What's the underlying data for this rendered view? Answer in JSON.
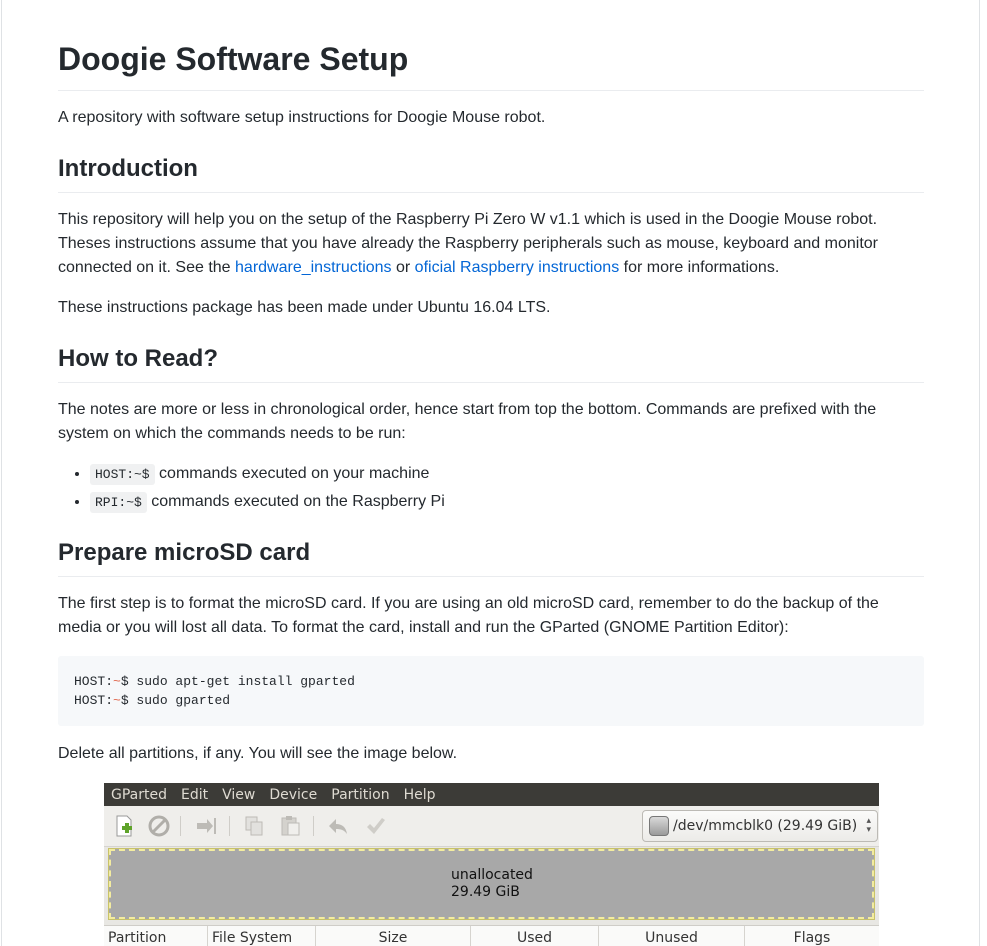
{
  "title": "Doogie Software Setup",
  "intro": "A repository with software setup instructions for Doogie Mouse robot.",
  "sections": {
    "introduction": {
      "heading": "Introduction",
      "p1_part1": "This repository will help you on the setup of the Raspberry Pi Zero W v1.1 which is used in the Doogie Mouse robot. Theses instructions assume that you have already the Raspberry peripherals such as mouse, keyboard and monitor connected on it. See the ",
      "link1": "hardware_instructions",
      "p1_part2": " or ",
      "link2": "oficial Raspberry instructions",
      "p1_part3": " for more informations.",
      "p2": "These instructions package has been made under Ubuntu 16.04 LTS."
    },
    "how_to_read": {
      "heading": "How to Read?",
      "p1": "The notes are more or less in chronological order, hence start from top the bottom. Commands are prefixed with the system on which the commands needs to be run:",
      "items": [
        {
          "code": "HOST:~$",
          "text": " commands executed on your machine"
        },
        {
          "code": "RPI:~$",
          "text": " commands executed on the Raspberry Pi"
        }
      ]
    },
    "prepare": {
      "heading": "Prepare microSD card",
      "p1": "The first step is to format the microSD card. If you are using an old microSD card, remember to do the backup of the media or you will lost all data. To format the card, install and run the GParted (GNOME Partition Editor):",
      "code_lines": [
        {
          "prefix": "HOST:",
          "tilde": "~",
          "rest": "$ sudo apt-get install gparted"
        },
        {
          "prefix": "HOST:",
          "tilde": "~",
          "rest": "$ sudo gparted"
        }
      ],
      "p2": "Delete all partitions, if any. You will see the image below."
    }
  },
  "gparted": {
    "menu": [
      "GParted",
      "Edit",
      "View",
      "Device",
      "Partition",
      "Help"
    ],
    "device": "/dev/mmcblk0  (29.49 GiB)",
    "unallocated_label": "unallocated",
    "unallocated_size": "29.49 GiB",
    "columns": [
      "Partition",
      "File System",
      "Size",
      "Used",
      "Unused",
      "Flags"
    ],
    "colors": {
      "menubar": "#3c3b37",
      "unallocated": "#a8a8a8"
    }
  }
}
